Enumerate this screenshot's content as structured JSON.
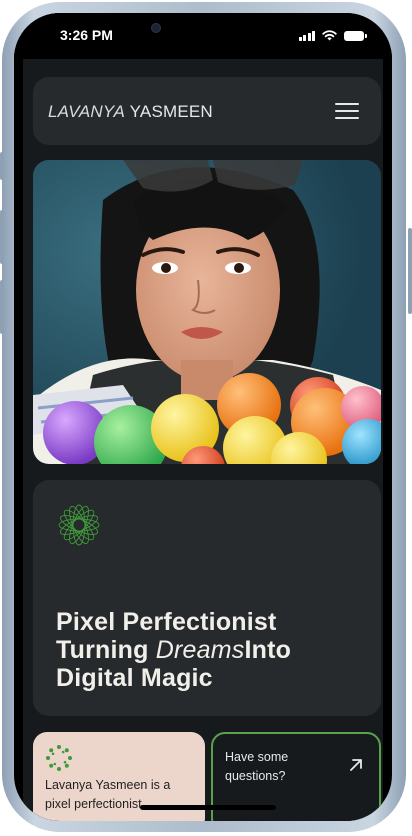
{
  "status_bar": {
    "time": "3:26 PM"
  },
  "header": {
    "brand_first": "LAVANYA",
    "brand_last": "YASMEEN"
  },
  "tagline": {
    "line1": "Pixel Perfectionist",
    "line2_start": "Turning ",
    "line2_italic": "Dreams",
    "line2_end": "Into",
    "line3": "Digital Magic"
  },
  "about": {
    "text": "Lavanya Yasmeen is a pixel perfectionist"
  },
  "contact": {
    "text": "Have some questions?"
  },
  "colors": {
    "background": "#171a1c",
    "card": "#262a2c",
    "accent_green": "#5aa24a",
    "about_card": "#ecd6cc"
  }
}
